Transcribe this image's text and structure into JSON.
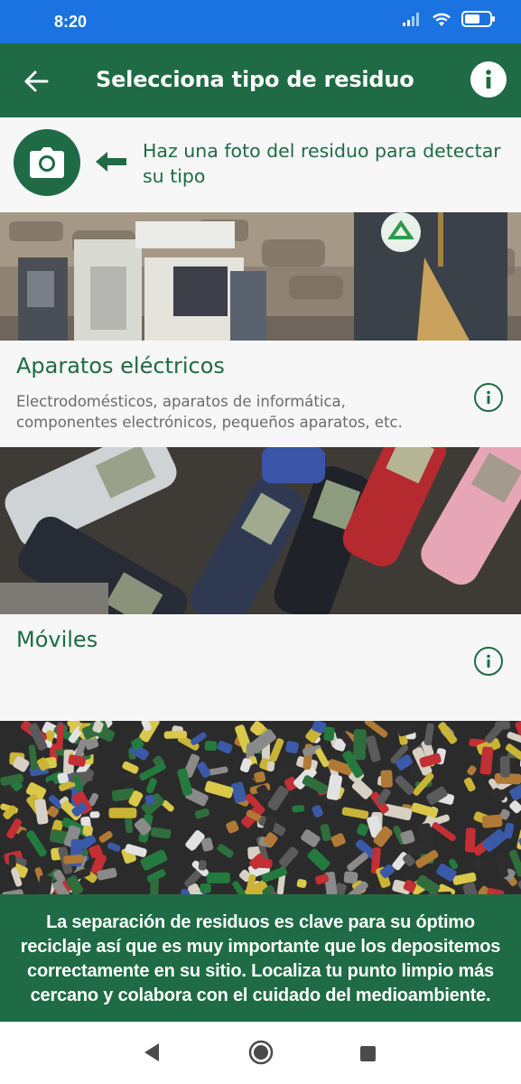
{
  "status_bar": {
    "time": "8:20",
    "icons": [
      "signal-icon",
      "wifi-icon",
      "battery-icon"
    ]
  },
  "app_bar": {
    "title": "Selecciona tipo de residuo",
    "back_icon": "arrow-left-icon",
    "info_icon": "info-icon"
  },
  "photo_row": {
    "text": "Haz una foto del residuo para detectar su tipo",
    "icon": "camera-icon"
  },
  "categories": [
    {
      "title": "Aparatos eléctricos",
      "description": "Electrodomésticos, aparatos de informática, componentes electrónicos, pequeños aparatos, etc."
    },
    {
      "title": "Móviles",
      "description": ""
    }
  ],
  "banner": {
    "text": "La separación de residuos es clave para su óptimo reciclaje así que es muy importante que los depositemos correctamente en su sitio. Localiza tu punto limpio más cercano y colabora con el cuidado del medioambiente."
  },
  "colors": {
    "status_bar": "#1a73e0",
    "primary_green": "#1e6b45",
    "background": "#f7f7f7"
  }
}
